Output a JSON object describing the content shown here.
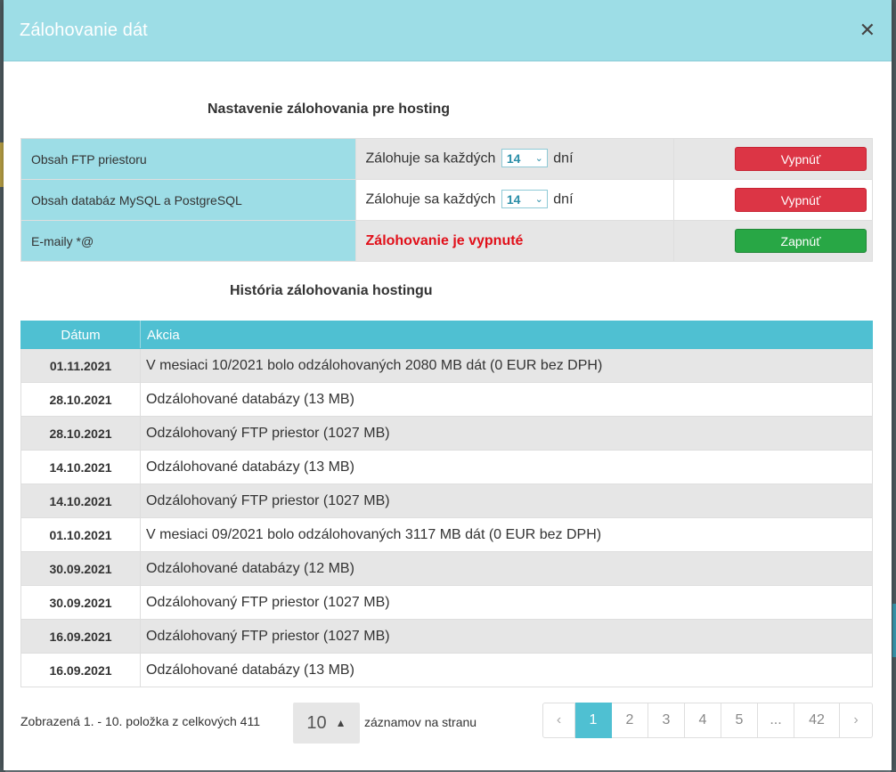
{
  "modal": {
    "title": "Zálohovanie dát",
    "close_icon": "close-icon"
  },
  "settings": {
    "title": "Nastavenie zálohovania pre hosting",
    "rows": [
      {
        "label": "Obsah FTP priestoru",
        "prefix": "Zálohuje sa každých",
        "days": "14",
        "suffix": "dní",
        "button": "Vypnúť",
        "button_color": "#dc3545"
      },
      {
        "label": "Obsah databáz MySQL a PostgreSQL",
        "prefix": "Zálohuje sa každých",
        "days": "14",
        "suffix": "dní",
        "button": "Vypnúť",
        "button_color": "#dc3545"
      },
      {
        "label": "E-maily *@",
        "status": "Zálohovanie je vypnuté",
        "button": "Zapnúť",
        "button_color": "#28a745"
      }
    ]
  },
  "history": {
    "title": "História zálohovania hostingu",
    "columns": [
      "Dátum",
      "Akcia"
    ],
    "rows": [
      {
        "date": "01.11.2021",
        "action": "V mesiaci 10/2021 bolo odzálohovaných 2080 MB dát (0 EUR bez DPH)"
      },
      {
        "date": "28.10.2021",
        "action": "Odzálohované databázy (13 MB)"
      },
      {
        "date": "28.10.2021",
        "action": "Odzálohovaný FTP priestor (1027 MB)"
      },
      {
        "date": "14.10.2021",
        "action": "Odzálohované databázy (13 MB)"
      },
      {
        "date": "14.10.2021",
        "action": "Odzálohovaný FTP priestor (1027 MB)"
      },
      {
        "date": "01.10.2021",
        "action": "V mesiaci 09/2021 bolo odzálohovaných 3117 MB dát (0 EUR bez DPH)"
      },
      {
        "date": "30.09.2021",
        "action": "Odzálohované databázy (12 MB)"
      },
      {
        "date": "30.09.2021",
        "action": "Odzálohovaný FTP priestor (1027 MB)"
      },
      {
        "date": "16.09.2021",
        "action": "Odzálohovaný FTP priestor (1027 MB)"
      },
      {
        "date": "16.09.2021",
        "action": "Odzálohované databázy (13 MB)"
      }
    ]
  },
  "footer": {
    "summary": "Zobrazená 1. - 10. položka z celkových 411",
    "per_page": "10",
    "per_page_label": "záznamov na stranu",
    "pages": [
      "‹",
      "1",
      "2",
      "3",
      "4",
      "5",
      "...",
      "42",
      "›"
    ],
    "active_page": "1",
    "accent": "#4fc0d2"
  }
}
